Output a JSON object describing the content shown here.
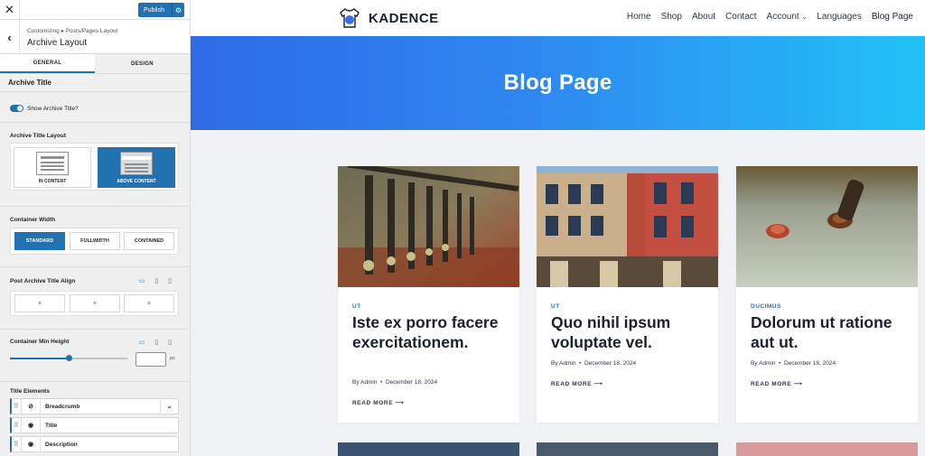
{
  "customizer": {
    "publish_label": "Publish",
    "breadcrumb": "Customizing ▸ Posts/Pages Layout",
    "panel_title": "Archive Layout",
    "tabs": [
      "GENERAL",
      "DESIGN"
    ],
    "section_title": "Archive Title",
    "show_title_label": "Show Archive Title?",
    "show_title_on": true,
    "title_layout_label": "Archive Title Layout",
    "layout_options": [
      "IN CONTENT",
      "ABOVE CONTENT"
    ],
    "layout_selected": "ABOVE CONTENT",
    "container_width_label": "Container Width",
    "width_options": [
      "STANDARD",
      "FULLWIDTH",
      "CONTAINED"
    ],
    "width_selected": "STANDARD",
    "align_label": "Post Archive Title Align",
    "min_height_label": "Container Min Height",
    "min_height_unit": "px",
    "min_height_slider_fraction": 0.5,
    "elements_label": "Title Elements",
    "elements": [
      "Breadcrumb",
      "Title",
      "Description"
    ],
    "accent": "#2271b1"
  },
  "site": {
    "logo_text": "KADENCE",
    "nav": [
      "Home",
      "Shop",
      "About",
      "Contact",
      "Account",
      "Languages",
      "Blog Page"
    ],
    "hero_title": "Blog Page",
    "posts": [
      {
        "category": "UT",
        "title": "Iste ex porro facere exercitationem.",
        "author": "By Admin",
        "date": "December 18, 2024",
        "more": "READ MORE ⟶"
      },
      {
        "category": "UT",
        "title": "Quo nihil ipsum voluptate vel.",
        "author": "By Admin",
        "date": "December 18, 2024",
        "more": "READ MORE ⟶"
      },
      {
        "category": "DUCIMUS",
        "title": "Dolorum ut ratione aut ut.",
        "author": "By Admin",
        "date": "December 18, 2024",
        "more": "READ MORE ⟶"
      }
    ]
  },
  "icons": {
    "close": "close-icon",
    "back": "chevron-left-icon",
    "gear": "gear-icon",
    "desktop": "desktop-icon",
    "tablet": "tablet-icon",
    "mobile": "mobile-icon",
    "eye": "eye-icon",
    "eye_hidden": "eye-slash-icon",
    "drag": "drag-handle-icon"
  }
}
